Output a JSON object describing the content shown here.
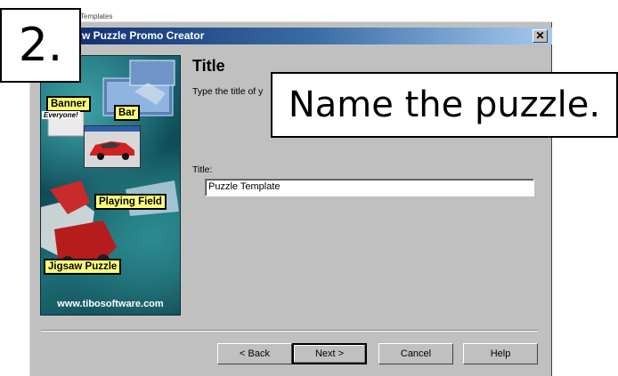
{
  "window": {
    "title": "w Puzzle Promo Creator",
    "close_symbol": "✕",
    "partial_text_above": "Templates"
  },
  "side_image": {
    "labels": {
      "banner": "Banner",
      "bar": "Bar",
      "everyone": "Everyone!",
      "playing_field": "Playing Field",
      "jigsaw_puzzle": "Jigsaw Puzzle"
    },
    "url": "www.tibosoftware.com"
  },
  "page": {
    "heading": "Title",
    "description": "Type the title of y",
    "field_label": "Title:",
    "title_value": "Puzzle Template"
  },
  "buttons": {
    "back": "< Back",
    "next": "Next >",
    "cancel": "Cancel",
    "help": "Help"
  },
  "overlay": {
    "step_number": "2.",
    "instruction": "Name the puzzle."
  },
  "colors": {
    "dialog_bg": "#c0c0c0",
    "titlebar_start": "#0a246a",
    "titlebar_end": "#a6caf0",
    "label_yellow": "#ffff7a",
    "image_teal": "#1c6c78"
  }
}
